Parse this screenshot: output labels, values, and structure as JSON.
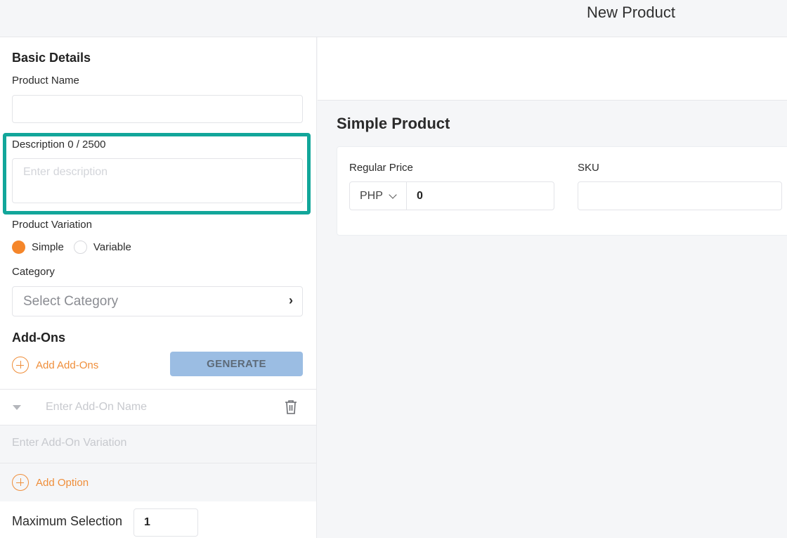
{
  "header": {
    "title": "New Product"
  },
  "basic_details": {
    "title": "Basic Details",
    "product_name": {
      "label": "Product Name",
      "value": "",
      "placeholder": ""
    },
    "description": {
      "label": "Description 0 / 2500",
      "value": "",
      "placeholder": "Enter description"
    },
    "variation": {
      "label": "Product Variation",
      "options": [
        {
          "label": "Simple",
          "selected": true
        },
        {
          "label": "Variable",
          "selected": false
        }
      ]
    },
    "category": {
      "label": "Category",
      "placeholder": "Select Category",
      "chevron": "chevron-right-icon"
    }
  },
  "addons": {
    "title": "Add-Ons",
    "add_label": "Add Add-Ons",
    "generate_label": "GENERATE",
    "addon_name_placeholder": "Enter Add-On Name",
    "addon_variation_placeholder": "Enter Add-On Variation",
    "add_option_label": "Add Option",
    "max_selection_label": "Maximum Selection",
    "max_selection_value": "1"
  },
  "simple_product": {
    "title": "Simple Product",
    "regular_price_label": "Regular Price",
    "currency": "PHP",
    "price_value": "0",
    "sku_label": "SKU",
    "sku_value": ""
  },
  "colors": {
    "accent": "#f5862a",
    "highlight": "#12a69a",
    "generate_button": "#9bbde3"
  }
}
